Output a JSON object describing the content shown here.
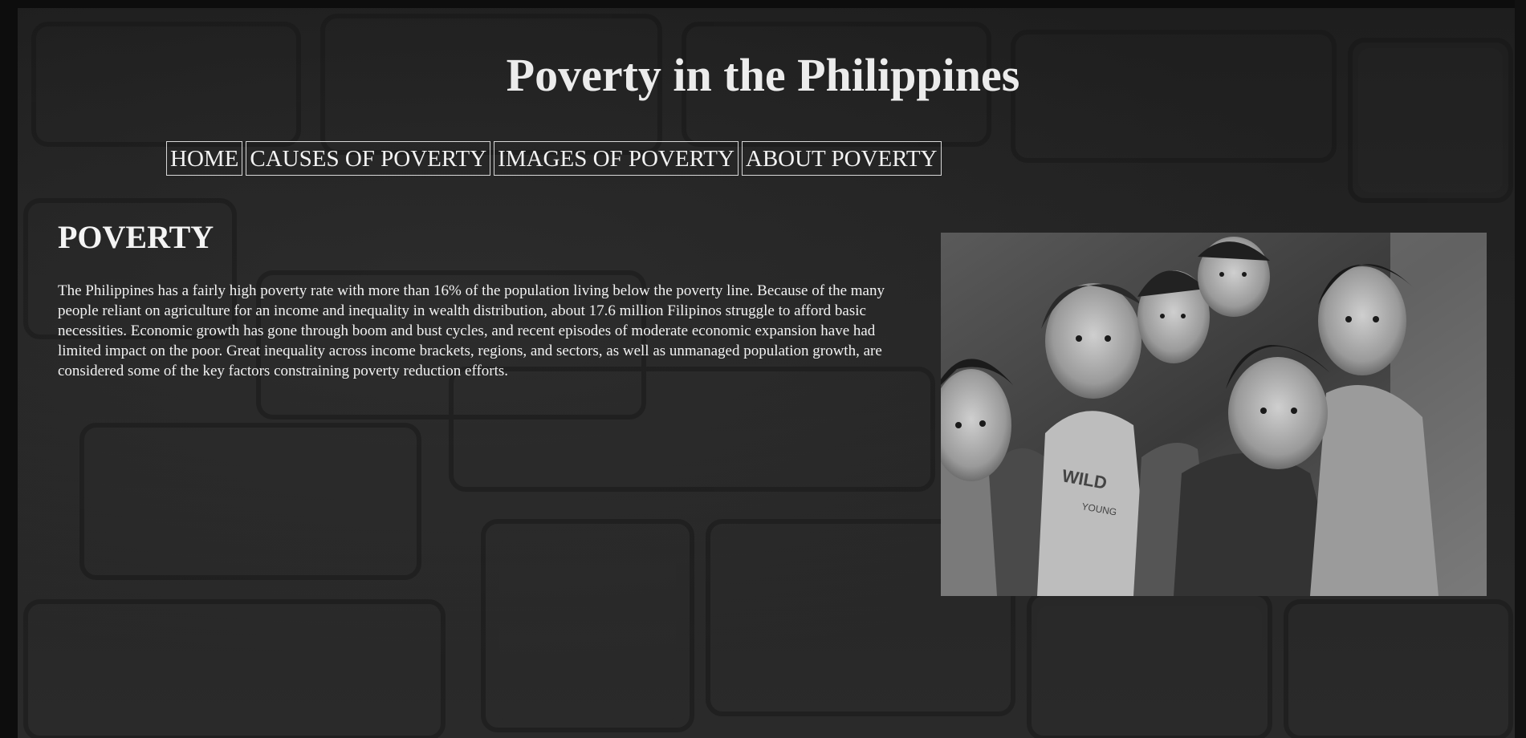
{
  "header": {
    "title": "Poverty in the Philippines"
  },
  "nav": {
    "items": [
      {
        "label": "HOME"
      },
      {
        "label": "CAUSES OF POVERTY"
      },
      {
        "label": "IMAGES OF POVERTY"
      },
      {
        "label": "ABOUT POVERTY"
      }
    ]
  },
  "main": {
    "heading": "POVERTY",
    "paragraph": "The Philippines has a fairly high poverty rate with more than 16% of the population living below the poverty line. Because of the many people reliant on agriculture for an income and inequality in wealth distribution, about 17.6 million Filipinos struggle to afford basic necessities. Economic growth has gone through boom and bust cycles, and recent episodes of moderate economic expansion have had limited impact on the poor. Great inequality across income brackets, regions, and sectors, as well as unmanaged population growth, are considered some of the key factors constraining poverty reduction efforts.",
    "photo_icon": "children-group-photo"
  },
  "colors": {
    "background": "#242424",
    "text": "#f2f2f2",
    "nav_border": "#d8d8d8"
  }
}
